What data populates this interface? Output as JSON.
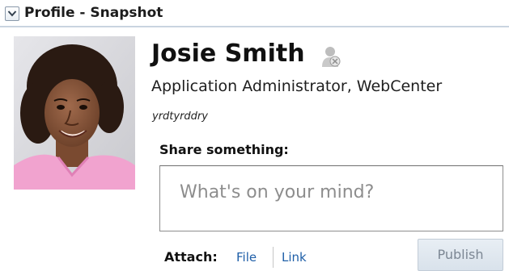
{
  "panel": {
    "title": "Profile - Snapshot"
  },
  "profile": {
    "name": "Josie Smith",
    "job_title": "Application Administrator, WebCenter",
    "status_message": "yrdtyrddry",
    "avatar_icon": "person-photo",
    "presence_icon": "presence-offline-icon"
  },
  "share": {
    "label": "Share something:",
    "placeholder": "What's on your mind?",
    "value": ""
  },
  "attach": {
    "label": "Attach:",
    "file_link": "File",
    "link_link": "Link"
  },
  "actions": {
    "publish_label": "Publish",
    "publish_enabled": false
  },
  "colors": {
    "link": "#1f5fa8",
    "header_rule": "#c9d4e0",
    "button_disabled_text": "#7c8794"
  }
}
